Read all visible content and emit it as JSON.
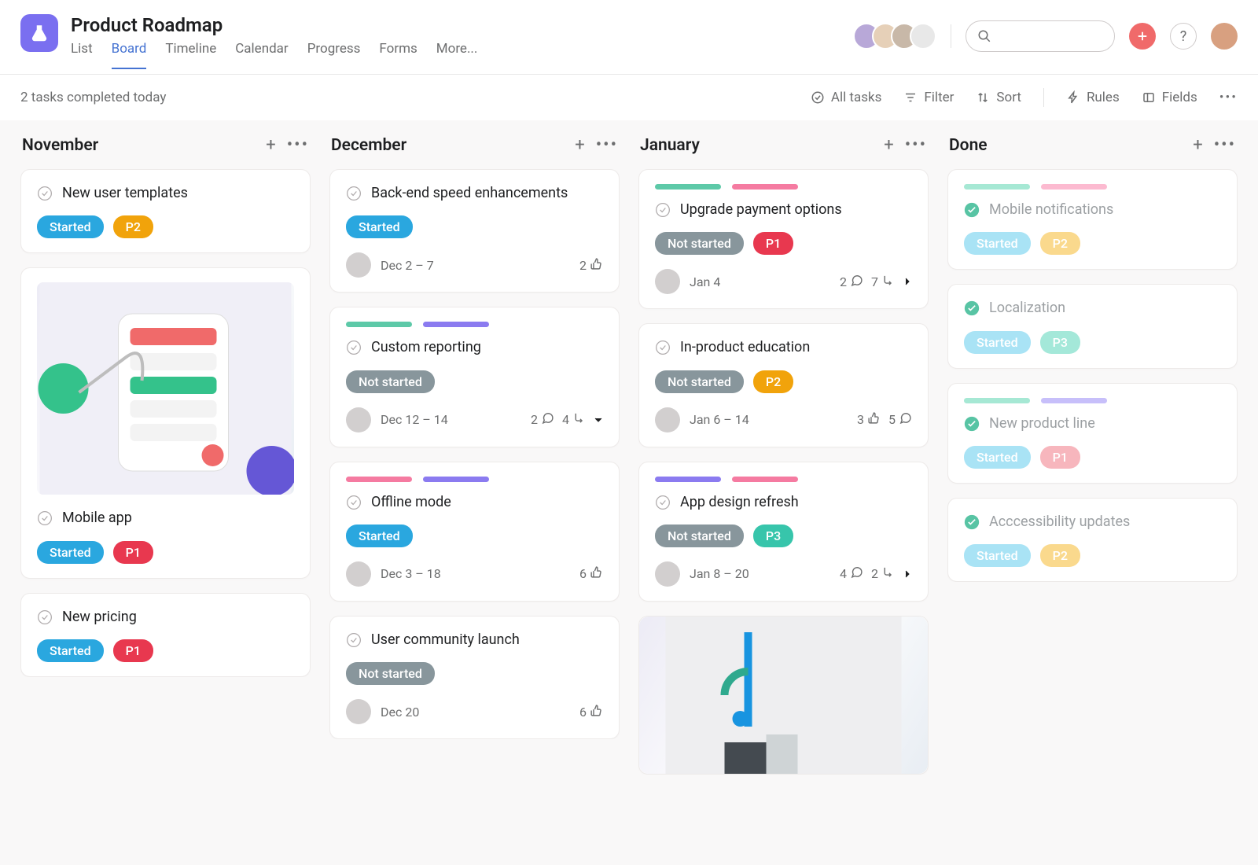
{
  "project": {
    "title": "Product Roadmap"
  },
  "tabs": [
    "List",
    "Board",
    "Timeline",
    "Calendar",
    "Progress",
    "Forms",
    "More..."
  ],
  "active_tab": "Board",
  "status_line": "2 tasks completed today",
  "controls": {
    "all_tasks": "All tasks",
    "filter": "Filter",
    "sort": "Sort",
    "rules": "Rules",
    "fields": "Fields"
  },
  "columns": [
    {
      "name": "November",
      "cards": [
        {
          "title": "New user templates",
          "status": "Started",
          "priority": "P2",
          "done": false
        },
        {
          "title": "Mobile app",
          "status": "Started",
          "priority": "P1",
          "done": false,
          "has_image": true
        },
        {
          "title": "New pricing",
          "status": "Started",
          "priority": "P1",
          "done": false
        }
      ]
    },
    {
      "name": "December",
      "cards": [
        {
          "title": "Back-end speed enhancements",
          "status": "Started",
          "done": false,
          "date": "Dec 2 – 7",
          "likes": 2
        },
        {
          "title": "Custom reporting",
          "status": "Not started",
          "done": false,
          "stripes": [
            "teal",
            "purple"
          ],
          "date": "Dec 12 – 14",
          "comments": 2,
          "subtasks": 4,
          "show_dropdown": true
        },
        {
          "title": "Offline mode",
          "status": "Started",
          "done": false,
          "stripes": [
            "pink",
            "purple"
          ],
          "date": "Dec 3 – 18",
          "likes": 6
        },
        {
          "title": "User community launch",
          "status": "Not started",
          "done": false,
          "date": "Dec 20",
          "likes": 6
        }
      ]
    },
    {
      "name": "January",
      "cards": [
        {
          "title": "Upgrade payment options",
          "status": "Not started",
          "priority": "P1",
          "done": false,
          "stripes": [
            "teal",
            "pink"
          ],
          "date": "Jan 4",
          "comments": 2,
          "subtasks": 7,
          "show_more": true
        },
        {
          "title": "In-product education",
          "status": "Not started",
          "priority": "P2",
          "done": false,
          "date": "Jan 6 – 14",
          "likes": 3,
          "comments": 5
        },
        {
          "title": "App design refresh",
          "status": "Not started",
          "priority": "P3",
          "done": false,
          "stripes": [
            "purple",
            "pink"
          ],
          "date": "Jan 8 – 20",
          "comments": 4,
          "subtasks": 2,
          "show_more": true
        },
        {
          "has_image_only": true
        }
      ]
    },
    {
      "name": "Done",
      "cards": [
        {
          "title": "Mobile notifications",
          "status": "Started",
          "priority": "P2",
          "done": true,
          "stripes": [
            "teal",
            "pink"
          ]
        },
        {
          "title": "Localization",
          "status": "Started",
          "priority": "P3",
          "done": true
        },
        {
          "title": "New product line",
          "status": "Started",
          "priority": "P1",
          "done": true,
          "stripes": [
            "teal",
            "purple"
          ]
        },
        {
          "title": "Acccessibility updates",
          "status": "Started",
          "priority": "P2",
          "done": true
        }
      ]
    }
  ]
}
